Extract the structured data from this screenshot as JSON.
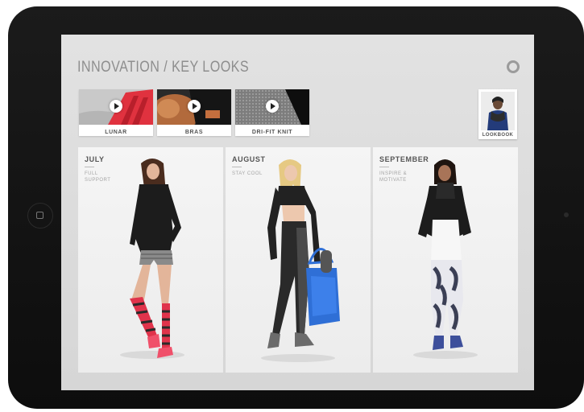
{
  "page": {
    "title": "INNOVATION / KEY LOOKS"
  },
  "videos": [
    {
      "label": "LUNAR"
    },
    {
      "label": "BRAS"
    },
    {
      "label": "DRI-FIT KNIT"
    }
  ],
  "lookbook": {
    "label": "LOOKBOOK"
  },
  "cards": [
    {
      "month": "JULY",
      "caption": "FULL SUPPORT"
    },
    {
      "month": "AUGUST",
      "caption": "STAY COOL"
    },
    {
      "month": "SEPTEMBER",
      "caption": "INSPIRE & MOTIVATE"
    }
  ],
  "icons": {
    "settings": "ring-icon",
    "play": "play-icon",
    "home": "home-button-icon"
  }
}
